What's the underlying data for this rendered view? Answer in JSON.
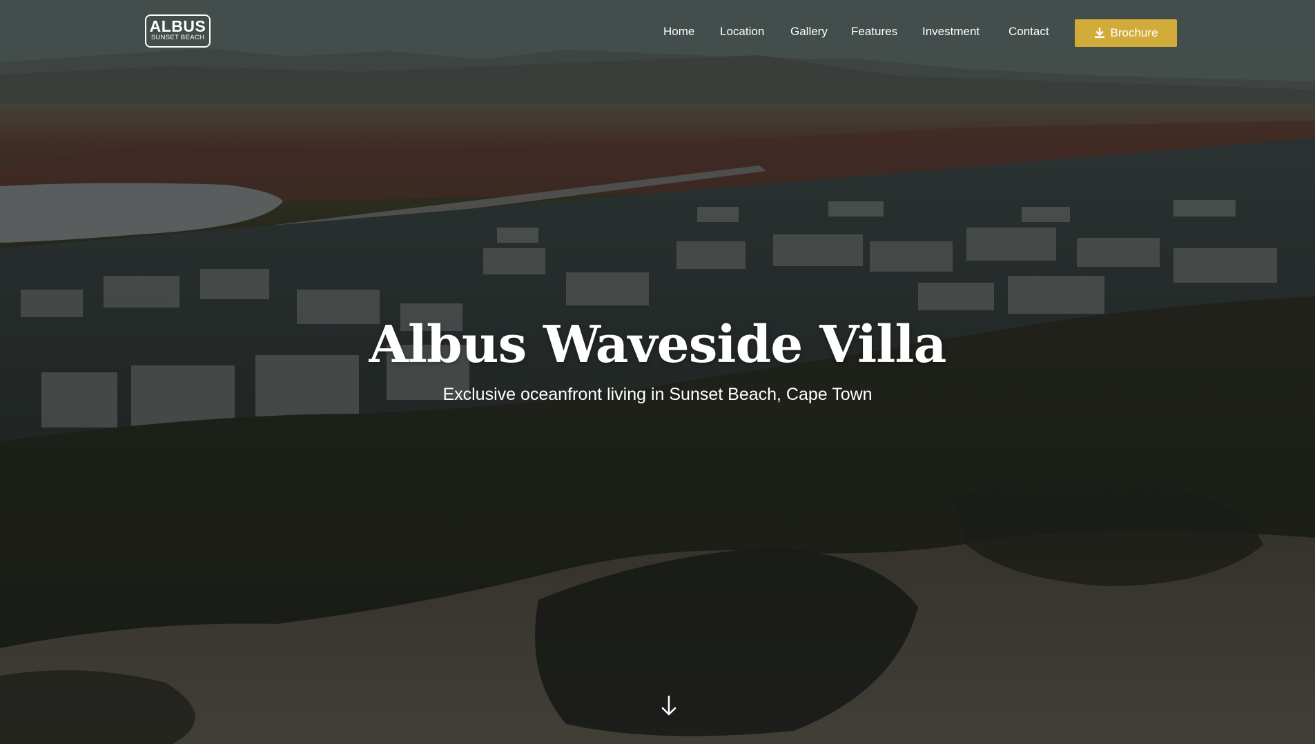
{
  "navbar": {
    "logo": {
      "main": "ALBUS",
      "sub": "SUNSET BEACH"
    },
    "links": [
      {
        "label": "Home"
      },
      {
        "label": "Location"
      },
      {
        "label": "Gallery"
      },
      {
        "label": "Features"
      },
      {
        "label": "Investment"
      },
      {
        "label": "Contact"
      }
    ],
    "brochure_button": {
      "label": "Brochure",
      "icon": "download-icon"
    }
  },
  "hero": {
    "title": "Albus Waveside Villa",
    "subtitle": "Exclusive oceanfront living in Sunset Beach, Cape Town",
    "scroll_icon": "arrow-down-icon"
  },
  "colors": {
    "accent": "#d2ac3a",
    "text": "#ffffff"
  }
}
